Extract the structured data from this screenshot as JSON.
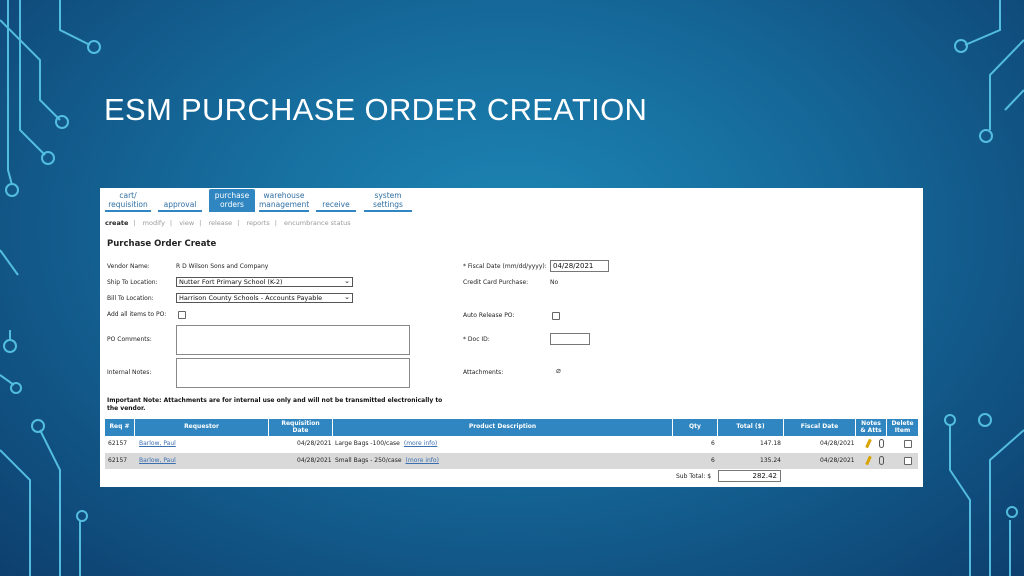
{
  "slide": {
    "title": "ESM PURCHASE ORDER CREATION"
  },
  "nav": {
    "tabs": [
      {
        "l1": "cart/",
        "l2": "requisition"
      },
      {
        "l1": "",
        "l2": "approval"
      },
      {
        "l1": "purchase",
        "l2": "orders"
      },
      {
        "l1": "warehouse",
        "l2": "management"
      },
      {
        "l1": "",
        "l2": "receive"
      },
      {
        "l1": "system",
        "l2": "settings"
      }
    ],
    "subnav": [
      "create",
      "modify",
      "view",
      "release",
      "reports",
      "encumbrance status"
    ]
  },
  "form": {
    "title": "Purchase Order Create",
    "vendor_label": "Vendor Name:",
    "vendor_value": "R D Wilson Sons and Company",
    "ship_label": "Ship To Location:",
    "ship_value": "Nutter Fort Primary School (K-2)",
    "bill_label": "Bill To Location:",
    "bill_value": "Harrison County Schools - Accounts Payable",
    "add_all_label": "Add all items to PO:",
    "po_comments_label": "PO Comments:",
    "internal_notes_label": "Internal Notes:",
    "fiscal_date_label": "* Fiscal Date (mm/dd/yyyy):",
    "fiscal_date_value": "04/28/2021",
    "credit_card_label": "Credit Card Purchase:",
    "credit_card_value": "No",
    "auto_release_label": "Auto Release PO:",
    "doc_id_label": "* Doc ID:",
    "attachments_label": "Attachments:",
    "important_note": "Important Note: Attachments are for internal use only and will not be transmitted electronically to the vendor."
  },
  "table": {
    "headers": {
      "req": "Req #",
      "requestor": "Requestor",
      "req_date_l1": "Requisition",
      "req_date_l2": "Date",
      "desc": "Product Description",
      "qty": "Qty",
      "total": "Total ($)",
      "fiscal": "Fiscal Date",
      "notes_l1": "Notes",
      "notes_l2": "& Atts",
      "delete_l1": "Delete",
      "delete_l2": "Item"
    },
    "rows": [
      {
        "req": "62157",
        "requestor": "Barlow, Paul",
        "date": "04/28/2021",
        "desc": "Large Bags -100/case",
        "more": "(more info)",
        "qty": "6",
        "total": "147.18",
        "fiscal": "04/28/2021"
      },
      {
        "req": "62157",
        "requestor": "Barlow, Paul",
        "date": "04/28/2021",
        "desc": "Small Bags - 250/case",
        "more": "(more info)",
        "qty": "6",
        "total": "135.24",
        "fiscal": "04/28/2021"
      }
    ],
    "subtotal_label": "Sub Total: $",
    "subtotal_value": "282.42"
  },
  "icons": {
    "notes": "pencil-icon",
    "attach": "paperclip-icon"
  }
}
